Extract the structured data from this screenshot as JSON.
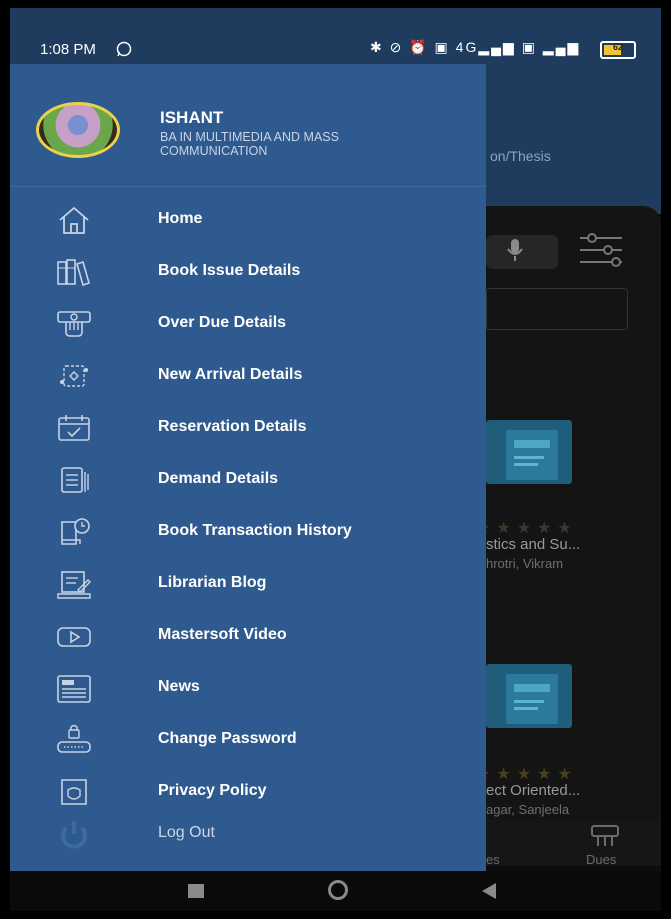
{
  "status_bar": {
    "time": "1:08 PM",
    "icons_text": "✱ ⊘ ⏰ ▣ 4G▂▄▆ ▣ ▂▄▆",
    "battery": "62"
  },
  "user": {
    "name": "ISHANT",
    "course": "BA IN MULTIMEDIA AND MASS COMMUNICATION"
  },
  "menu": [
    {
      "label": "Home",
      "icon": "home-icon"
    },
    {
      "label": "Book Issue Details",
      "icon": "books-icon"
    },
    {
      "label": "Over Due Details",
      "icon": "overdue-icon"
    },
    {
      "label": "New Arrival Details",
      "icon": "new-arrival-icon"
    },
    {
      "label": "Reservation Details",
      "icon": "calendar-check-icon"
    },
    {
      "label": "Demand Details",
      "icon": "demand-list-icon"
    },
    {
      "label": "Book Transaction History",
      "icon": "transaction-history-icon"
    },
    {
      "label": "Librarian Blog",
      "icon": "blog-icon"
    },
    {
      "label": "Mastersoft Video",
      "icon": "video-play-icon"
    },
    {
      "label": "News",
      "icon": "newspaper-icon"
    },
    {
      "label": "Change Password",
      "icon": "password-lock-icon"
    },
    {
      "label": "Privacy Policy",
      "icon": "privacy-shield-icon"
    },
    {
      "label": "Log Out",
      "icon": "power-icon"
    }
  ],
  "background": {
    "tab_text": "on/Thesis",
    "book1": {
      "title": "stics and Su...",
      "author": "hrotri, Vikram"
    },
    "book2": {
      "title": "ect Oriented...",
      "author": "agar, Sanjeela"
    },
    "nav_labels": [
      "es",
      "Dues"
    ]
  }
}
